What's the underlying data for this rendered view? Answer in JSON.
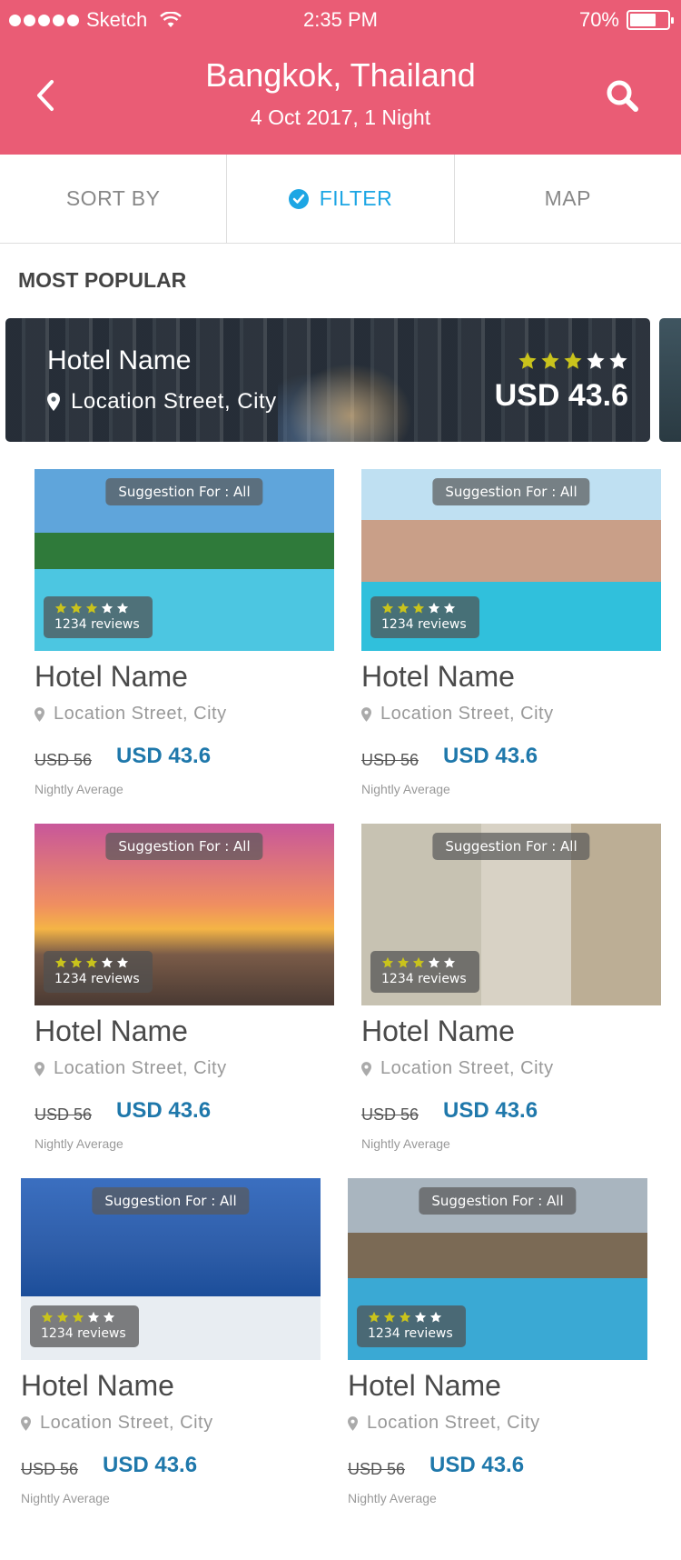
{
  "status_bar": {
    "carrier": "Sketch",
    "time": "2:35 PM",
    "battery": "70%",
    "battery_level": 0.7
  },
  "header": {
    "title": "Bangkok, Thailand",
    "subtitle": "4 Oct 2017, 1 Night",
    "background_color": "#ea5c75"
  },
  "tabs": [
    {
      "label": "SORT BY",
      "active": false
    },
    {
      "label": "FILTER",
      "active": true
    },
    {
      "label": "MAP",
      "active": false
    }
  ],
  "accent_color": "#1da6e4",
  "section_title": "MOST POPULAR",
  "featured": {
    "name": "Hotel Name",
    "location": "Location Street, City",
    "price": "USD 43.6",
    "rating": 3,
    "max_rating": 5
  },
  "hotels": [
    {
      "badge": "Suggestion For : All",
      "reviews": "1234 reviews",
      "rating": 3,
      "name": "Hotel Name",
      "location": "Location Street, City",
      "old_price": "USD 56",
      "price": "USD 43.6",
      "price_note": "Nightly Average"
    },
    {
      "badge": "Suggestion For : All",
      "reviews": "1234 reviews",
      "rating": 3,
      "name": "Hotel Name",
      "location": "Location Street, City",
      "old_price": "USD 56",
      "price": "USD 43.6",
      "price_note": "Nightly Average"
    },
    {
      "badge": "Suggestion For : All",
      "reviews": "1234 reviews",
      "rating": 3,
      "name": "Hotel Name",
      "location": "Location Street, City",
      "old_price": "USD 56",
      "price": "USD 43.6",
      "price_note": "Nightly Average"
    },
    {
      "badge": "Suggestion For : All",
      "reviews": "1234 reviews",
      "rating": 3,
      "name": "Hotel Name",
      "location": "Location Street, City",
      "old_price": "USD 56",
      "price": "USD 43.6",
      "price_note": "Nightly Average"
    },
    {
      "badge": "Suggestion For : All",
      "reviews": "1234 reviews",
      "rating": 3,
      "name": "Hotel Name",
      "location": "Location Street, City",
      "old_price": "USD 56",
      "price": "USD 43.6",
      "price_note": "Nightly Average"
    },
    {
      "badge": "Suggestion For : All",
      "reviews": "1234 reviews",
      "rating": 3,
      "name": "Hotel Name",
      "location": "Location Street, City",
      "old_price": "USD 56",
      "price": "USD 43.6",
      "price_note": "Nightly Average"
    }
  ],
  "icons": {
    "back": "chevron-left-icon",
    "search": "search-icon",
    "filter_check": "check-circle-icon",
    "location": "location-pin-icon",
    "star": "star-icon"
  },
  "star_filled_color": "#c9c31c",
  "star_empty_color": "#ffffff"
}
